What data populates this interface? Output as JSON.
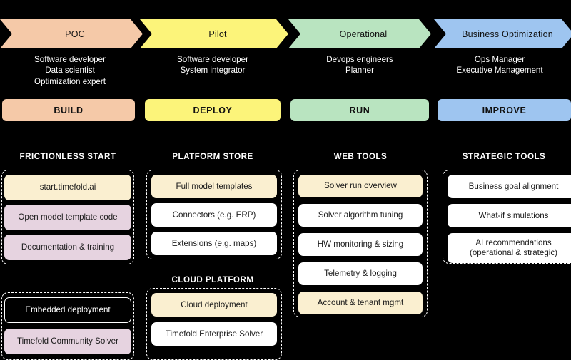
{
  "colors": {
    "background": "#000000",
    "poc": "#f5c9a8",
    "pilot": "#fcf47a",
    "operational": "#b9e4c0",
    "business": "#9ec5f0",
    "cream": "#faefd0",
    "lavender": "#e6d3e0",
    "white": "#ffffff",
    "dark_card": "#000000",
    "text_light": "#ffffff",
    "text_dark": "#1b1b1b"
  },
  "stages": [
    {
      "name": "POC",
      "color": "#f5c9a8",
      "personas": "Software developer\nData scientist\nOptimization expert",
      "persona_lines": [
        "Software developer",
        "Data scientist",
        "Optimization expert"
      ],
      "band_label": "BUILD",
      "band_color": "#f5c9a8"
    },
    {
      "name": "Pilot",
      "color": "#fcf47a",
      "personas": "Software developer\nSystem integrator",
      "persona_lines": [
        "Software developer",
        "System integrator"
      ],
      "band_label": "DEPLOY",
      "band_color": "#fcf47a"
    },
    {
      "name": "Operational",
      "color": "#b9e4c0",
      "personas": "Devops engineers\nPlanner",
      "persona_lines": [
        "Devops engineers",
        "Planner"
      ],
      "band_label": "RUN",
      "band_color": "#b9e4c0"
    },
    {
      "name": "Business Optimization",
      "color": "#9ec5f0",
      "personas": "Ops Manager\nExecutive Management",
      "persona_lines": [
        "Ops Manager",
        "Executive Management"
      ],
      "band_label": "IMPROVE",
      "band_color": "#9ec5f0"
    }
  ],
  "sections": [
    {
      "title": "FRICTIONLESS START",
      "cards": [
        {
          "label": "start.timefold.ai",
          "style": "cream"
        },
        {
          "label": "Open model template code",
          "style": "lavender"
        },
        {
          "label": "Documentation & training",
          "style": "lavender"
        }
      ],
      "extra_cards": [
        {
          "label": "Embedded deployment",
          "style": "dark"
        },
        {
          "label": "Timefold Community Solver",
          "style": "lavender"
        }
      ]
    },
    {
      "title": "PLATFORM STORE",
      "cards": [
        {
          "label": "Full model templates",
          "style": "cream"
        },
        {
          "label": "Connectors (e.g. ERP)",
          "style": "white"
        },
        {
          "label": "Extensions (e.g. maps)",
          "style": "white"
        }
      ],
      "sub_title": "CLOUD PLATFORM",
      "sub_cards": [
        {
          "label": "Cloud deployment",
          "style": "cream"
        },
        {
          "label": "Timefold Enterprise Solver",
          "style": "white"
        }
      ]
    },
    {
      "title": "WEB TOOLS",
      "cards": [
        {
          "label": "Solver run overview",
          "style": "cream"
        },
        {
          "label": "Solver algorithm tuning",
          "style": "white"
        },
        {
          "label": "HW monitoring & sizing",
          "style": "white"
        },
        {
          "label": "Telemetry & logging",
          "style": "white"
        },
        {
          "label": "Account & tenant mgmt",
          "style": "cream"
        }
      ]
    },
    {
      "title": "STRATEGIC TOOLS",
      "cards": [
        {
          "label": "Business goal alignment",
          "style": "white"
        },
        {
          "label": "What-if simulations",
          "style": "white"
        },
        {
          "label": "AI recommendations\n(operational & strategic)",
          "style": "white"
        }
      ]
    }
  ]
}
